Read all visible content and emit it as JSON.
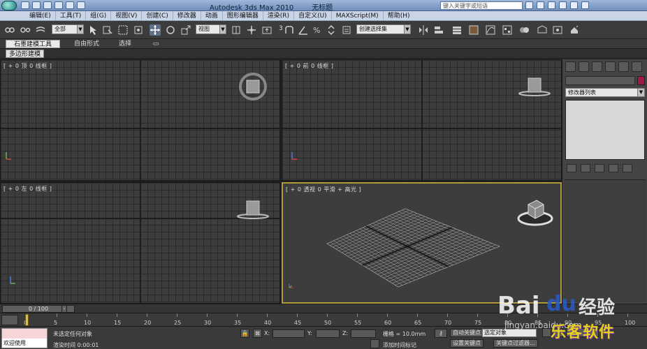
{
  "window": {
    "app_title": "Autodesk 3ds Max  2010",
    "doc_title": "无标题",
    "search_placeholder": "键入关键字或短语"
  },
  "menu": {
    "items": [
      "编辑(E)",
      "工具(T)",
      "组(G)",
      "视图(V)",
      "创建(C)",
      "修改器",
      "动画",
      "图形编辑器",
      "渲染(R)",
      "自定义(U)",
      "MAXScript(M)",
      "帮助(H)"
    ]
  },
  "toolbar": {
    "selection_filter": "全部",
    "coordinate_system": "视图",
    "snap_label": "3",
    "named_selection_set": "创建选择集"
  },
  "ribbon": {
    "tabs": [
      "石墨建模工具",
      "自由形式",
      "选择"
    ],
    "subtab": "多边形建模"
  },
  "viewports": {
    "top": "[ + 0 顶 0 线框 ]",
    "front": "[ + 0 前 0 线框 ]",
    "left": "[ + 0 左 0 线框 ]",
    "perspective": "[ + 0 透视 0 平滑 + 高光 ]"
  },
  "command_panel": {
    "modifier_list": "修改器列表"
  },
  "time_slider": {
    "position": "0 / 100",
    "frame": 0,
    "total": 100
  },
  "track_bar": {
    "ticks": [
      "0",
      "5",
      "10",
      "15",
      "20",
      "25",
      "30",
      "35",
      "40",
      "45",
      "50",
      "55",
      "60",
      "65",
      "70",
      "75",
      "80",
      "85",
      "90",
      "95",
      "100"
    ]
  },
  "status": {
    "maxscript_prompt": "欢迎使用 MAXScr",
    "selection_msg": "未选定任何对象",
    "render_time": "渲染时间  0:00:01",
    "x_label": "X:",
    "y_label": "Y:",
    "z_label": "Z:",
    "grid": "栅格 = 10.0mm",
    "add_time_tag": "添加时间标记",
    "auto_key": "自动关键点",
    "set_key": "设置关键点",
    "selected_dropdown": "选定对象",
    "key_filters": "关键点过滤器..."
  },
  "watermark": {
    "brand": "Bai",
    "brand_paw": "du",
    "brand_cn": "经验",
    "url": "jingyan.baidu.com",
    "corner": "乐客软件"
  },
  "colors": {
    "viewport_bg": "#3d3d3d",
    "grid_line": "#2b2b2b",
    "active_border": "#b49a3a",
    "object_color": "#a0184a"
  }
}
